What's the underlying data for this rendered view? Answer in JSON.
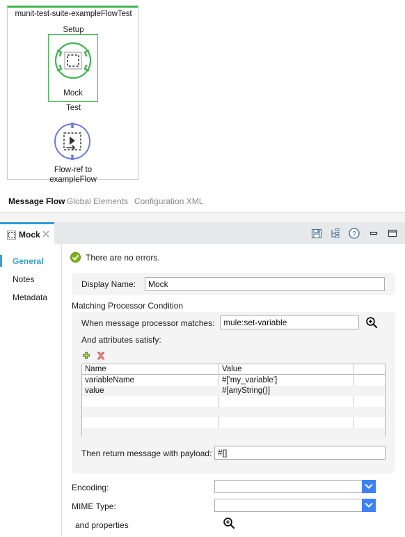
{
  "canvas": {
    "flow": {
      "title": "munit-test-suite-exampleFlowTest",
      "lanes": [
        {
          "label": "Setup"
        },
        {
          "label": "Test"
        }
      ],
      "nodes": [
        {
          "name": "mock-node",
          "icon": "mock-icon",
          "caption": "Mock",
          "color": "#3fb44f"
        },
        {
          "name": "flow-ref-node",
          "icon": "flow-ref-icon",
          "caption": "Flow-ref to exampleFlow",
          "color": "#6b77e8"
        }
      ]
    }
  },
  "view_tabs": [
    {
      "label": "Message Flow",
      "active": true
    },
    {
      "label": "Global Elements",
      "active": false
    },
    {
      "label": "Configuration XML",
      "active": false
    }
  ],
  "panel": {
    "tab": {
      "label": "Mock",
      "icon": "mock-icon",
      "close_icon": "close-icon"
    },
    "tools": [
      {
        "name": "save-icon",
        "title": "Save"
      },
      {
        "name": "link-tree-icon",
        "title": "Link"
      },
      {
        "name": "help-icon",
        "title": "Help"
      },
      {
        "name": "minimize-icon",
        "title": "Minimize"
      },
      {
        "name": "maximize-icon",
        "title": "Maximize"
      }
    ],
    "status": {
      "icon": "success-check-icon",
      "text": "There are no errors."
    },
    "sidenav": [
      {
        "label": "General",
        "selected": true
      },
      {
        "label": "Notes",
        "selected": false
      },
      {
        "label": "Metadata",
        "selected": false
      }
    ],
    "general": {
      "display_name_label": "Display Name:",
      "display_name_value": "Mock",
      "section_title": "Matching Processor Condition",
      "matches_label": "When message processor matches:",
      "matches_value": "mule:set-variable",
      "matches_search_icon": "magnifier-icon",
      "attributes_label": "And attributes satisfy:",
      "add_icon": "add-plus-icon",
      "delete_icon": "delete-x-icon",
      "table": {
        "columns": [
          "Name",
          "Value",
          ""
        ],
        "rows": [
          {
            "name": "variableName",
            "value": "#['my_variable']"
          },
          {
            "name": "value",
            "value": "#[anyString()]"
          },
          {
            "name": "",
            "value": ""
          },
          {
            "name": "",
            "value": ""
          },
          {
            "name": "",
            "value": ""
          },
          {
            "name": "",
            "value": ""
          }
        ]
      },
      "payload_label": "Then return message with payload:",
      "payload_value": "#[]",
      "encoding_label": "Encoding:",
      "encoding_value": "",
      "mime_label": "MIME Type:",
      "mime_value": "",
      "properties_label": "and properties",
      "properties_icon": "magnifier-icon"
    }
  },
  "colors": {
    "accent_blue": "#3a9fd8",
    "mock_green": "#3fb44f",
    "flowref_purple": "#6b77e8",
    "dropdown_blue": "#3b82f6"
  }
}
